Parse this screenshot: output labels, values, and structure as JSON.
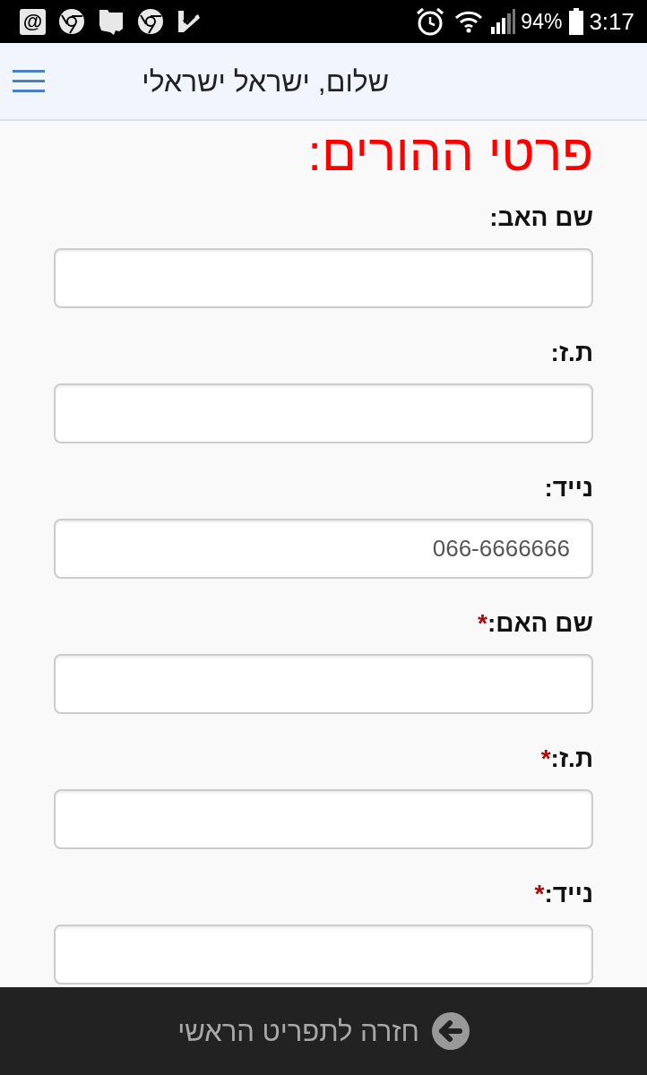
{
  "status_bar": {
    "email_icon_glyph": "@",
    "battery": "94%",
    "time": "3:17"
  },
  "header": {
    "greeting": "שלום, ישראל ישראלי"
  },
  "form": {
    "title": "פרטי ההורים:",
    "fields": [
      {
        "label": "שם האב:"
      },
      {
        "label": "ת.ז:"
      },
      {
        "label": "נייד:",
        "value": "066-6666666"
      },
      {
        "label": "שם האם:",
        "required_mark": "*"
      },
      {
        "label": "ת.ז:",
        "required_mark": "*"
      },
      {
        "label": "נייד:",
        "required_mark": "*"
      }
    ]
  },
  "footer": {
    "back_button": "חזרה לתפריט הראשי"
  }
}
